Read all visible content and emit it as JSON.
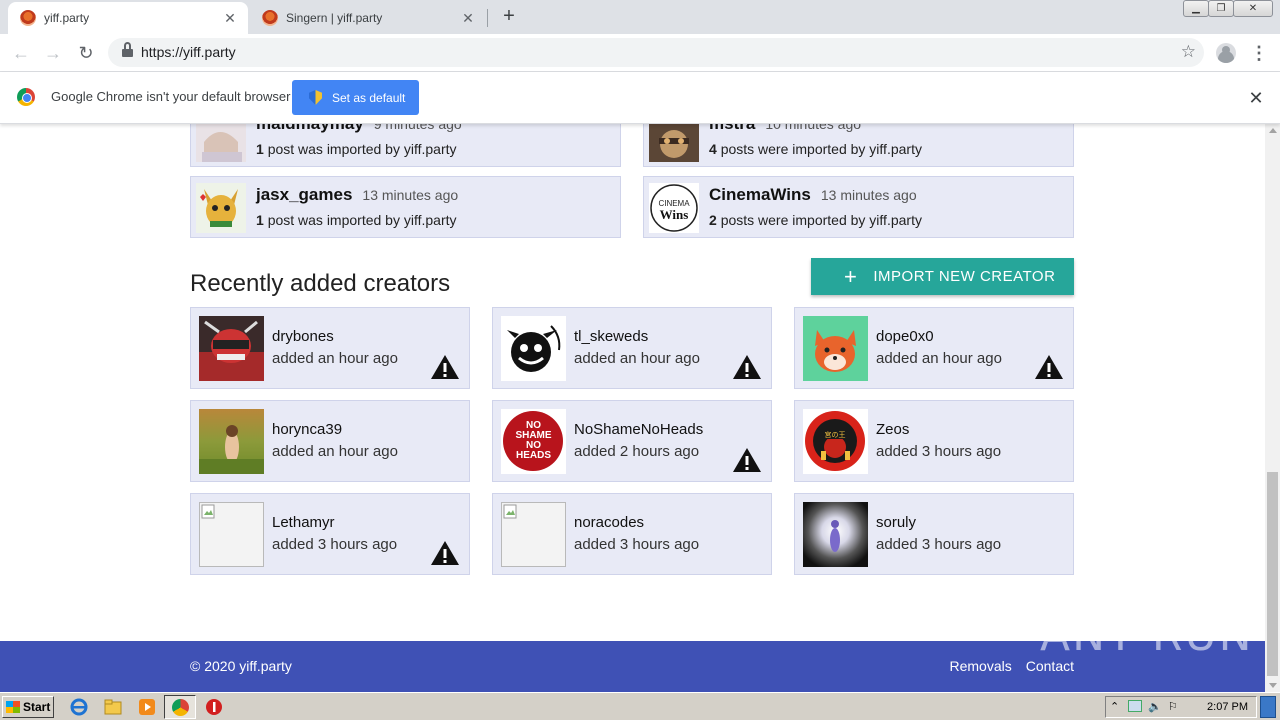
{
  "browser": {
    "tabs": [
      {
        "title": "yiff.party",
        "active": true
      },
      {
        "title": "Singern | yiff.party",
        "active": false
      }
    ],
    "new_tab_symbol": "+",
    "url": "https://yiff.party",
    "infobar": {
      "message": "Google Chrome isn't your default browser",
      "button_label": "Set as default",
      "close_symbol": "✕"
    }
  },
  "recent_imports": [
    {
      "name": "maidmaymay",
      "time": "9 minutes ago",
      "count": "1",
      "text": "post was imported by yiff.party"
    },
    {
      "name": "mstra",
      "time": "10 minutes ago",
      "count": "4",
      "text": "posts were imported by yiff.party"
    },
    {
      "name": "jasx_games",
      "time": "13 minutes ago",
      "count": "1",
      "text": "post was imported by yiff.party"
    },
    {
      "name": "CinemaWins",
      "time": "13 minutes ago",
      "count": "2",
      "text": "posts were imported by yiff.party"
    }
  ],
  "creators_section": {
    "title": "Recently added creators",
    "import_button": "IMPORT NEW CREATOR",
    "import_icon": "+"
  },
  "creators": [
    {
      "name": "drybones",
      "added": "added an hour ago",
      "warning": true
    },
    {
      "name": "tl_skeweds",
      "added": "added an hour ago",
      "warning": true
    },
    {
      "name": "dope0x0",
      "added": "added an hour ago",
      "warning": true
    },
    {
      "name": "horynca39",
      "added": "added an hour ago",
      "warning": false
    },
    {
      "name": "NoShameNoHeads",
      "added": "added 2 hours ago",
      "warning": true
    },
    {
      "name": "Zeos",
      "added": "added 3 hours ago",
      "warning": false
    },
    {
      "name": "Lethamyr",
      "added": "added 3 hours ago",
      "warning": true
    },
    {
      "name": "noracodes",
      "added": "added 3 hours ago",
      "warning": false
    },
    {
      "name": "soruly",
      "added": "added 3 hours ago",
      "warning": false
    }
  ],
  "avatar_text": {
    "cinemawins_line1": "CINEMA",
    "cinemawins_line2": "Wins",
    "noshame": "NO SHAME NO HEADS",
    "zeos": "宮の王"
  },
  "footer": {
    "copyright": "© 2020 yiff.party",
    "links": [
      "Removals",
      "Contact"
    ]
  },
  "watermark": "ANY RUN",
  "taskbar": {
    "start_label": "Start",
    "clock": "2:07 PM"
  },
  "colors": {
    "card_bg": "#e8eaf6",
    "import_button": "#26a69a",
    "footer": "#3f51b5",
    "chrome_blue": "#4285f4"
  }
}
